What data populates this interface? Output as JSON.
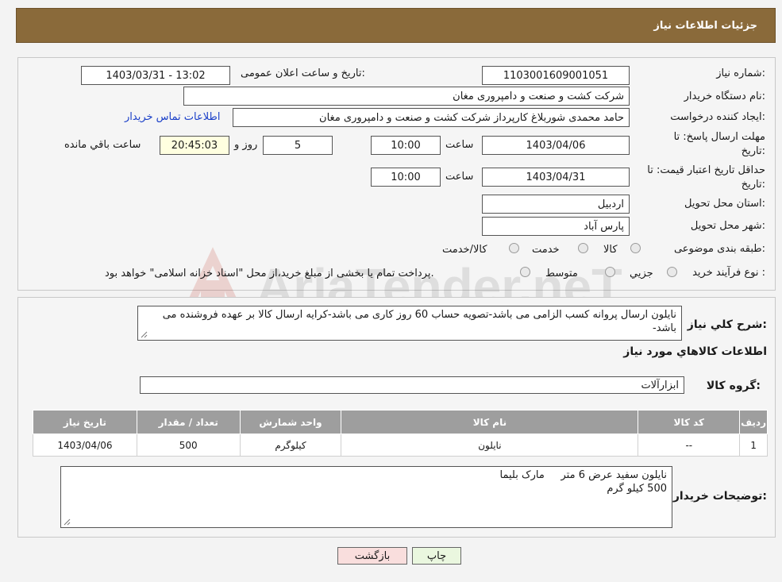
{
  "header": {
    "title": "جزئیات اطلاعات نیاز"
  },
  "form": {
    "need_number_label": "شماره نیاز:",
    "need_number": "1103001609001051",
    "announce_label": "تاریخ و ساعت اعلان عمومی:",
    "announce_value": "1403/03/31 - 13:02",
    "buyer_org_label": "نام دستگاه خریدار:",
    "buyer_org": "شرکت کشت و صنعت و دامپروری مغان",
    "creator_label": "ایجاد کننده درخواست:",
    "creator": "حامد محمدی شوربلاغ کارپرداز شرکت کشت و صنعت و دامپروری مغان",
    "contact_link": "اطلاعات تماس خریدار",
    "deadline_label_1": "مهلت ارسال پاسخ: تا",
    "deadline_label_2": "تاریخ:",
    "deadline_date": "1403/04/06",
    "time_label": "ساعت",
    "deadline_time": "10:00",
    "days_value": "5",
    "days_label": "روز و",
    "remaining_time": "20:45:03",
    "remaining_label": "ساعت باقي مانده",
    "validity_label_1": "حداقل تاریخ اعتبار قیمت: تا",
    "validity_label_2": "تاریخ:",
    "validity_date": "1403/04/31",
    "validity_time_label": "ساعت",
    "validity_time": "10:00",
    "province_label": "استان محل تحویل:",
    "province": "اردبیل",
    "city_label": "شهر محل تحویل:",
    "city": "پارس آباد",
    "category_label": "طبقه بندی موضوعی:",
    "category_options": [
      "کالا",
      "خدمت",
      "کالا/خدمت"
    ],
    "process_label": "نوع فرآیند خرید :",
    "process_options": [
      "جزیي",
      "متوسط"
    ],
    "payment_note": "پرداخت تمام یا بخشی از مبلغ خرید،از محل \"اسناد خزانه اسلامی\" خواهد بود."
  },
  "details": {
    "description_label": "شرح کلي نياز:",
    "description": "نایلون ارسال پروانه کسب الزامی می باشد-تصویه حساب 60 روز کاری می باشد-کرایه ارسال کالا بر عهده فروشنده می باشد-",
    "goods_info_title": "اطلاعات کالاهاي مورد نياز",
    "group_label": "گروه کالا:",
    "group_value": "ابزارآلات",
    "table": {
      "headers": [
        "ردیف",
        "کد کالا",
        "نام کالا",
        "واحد شمارش",
        "تعداد / مقدار",
        "تاریخ نیاز"
      ],
      "rows": [
        [
          "1",
          "--",
          "نایلون",
          "کیلوگرم",
          "500",
          "1403/04/06"
        ]
      ]
    },
    "buyer_notes_label": "توضیحات خریدار:",
    "buyer_notes_line1": "نایلون سفید عرض 6 متر     مارک بلیما",
    "buyer_notes_line2": "500 کیلو گرم"
  },
  "buttons": {
    "print": "چاپ",
    "back": "بازگشت"
  },
  "watermark": {
    "text": "AriaTender.neT"
  }
}
